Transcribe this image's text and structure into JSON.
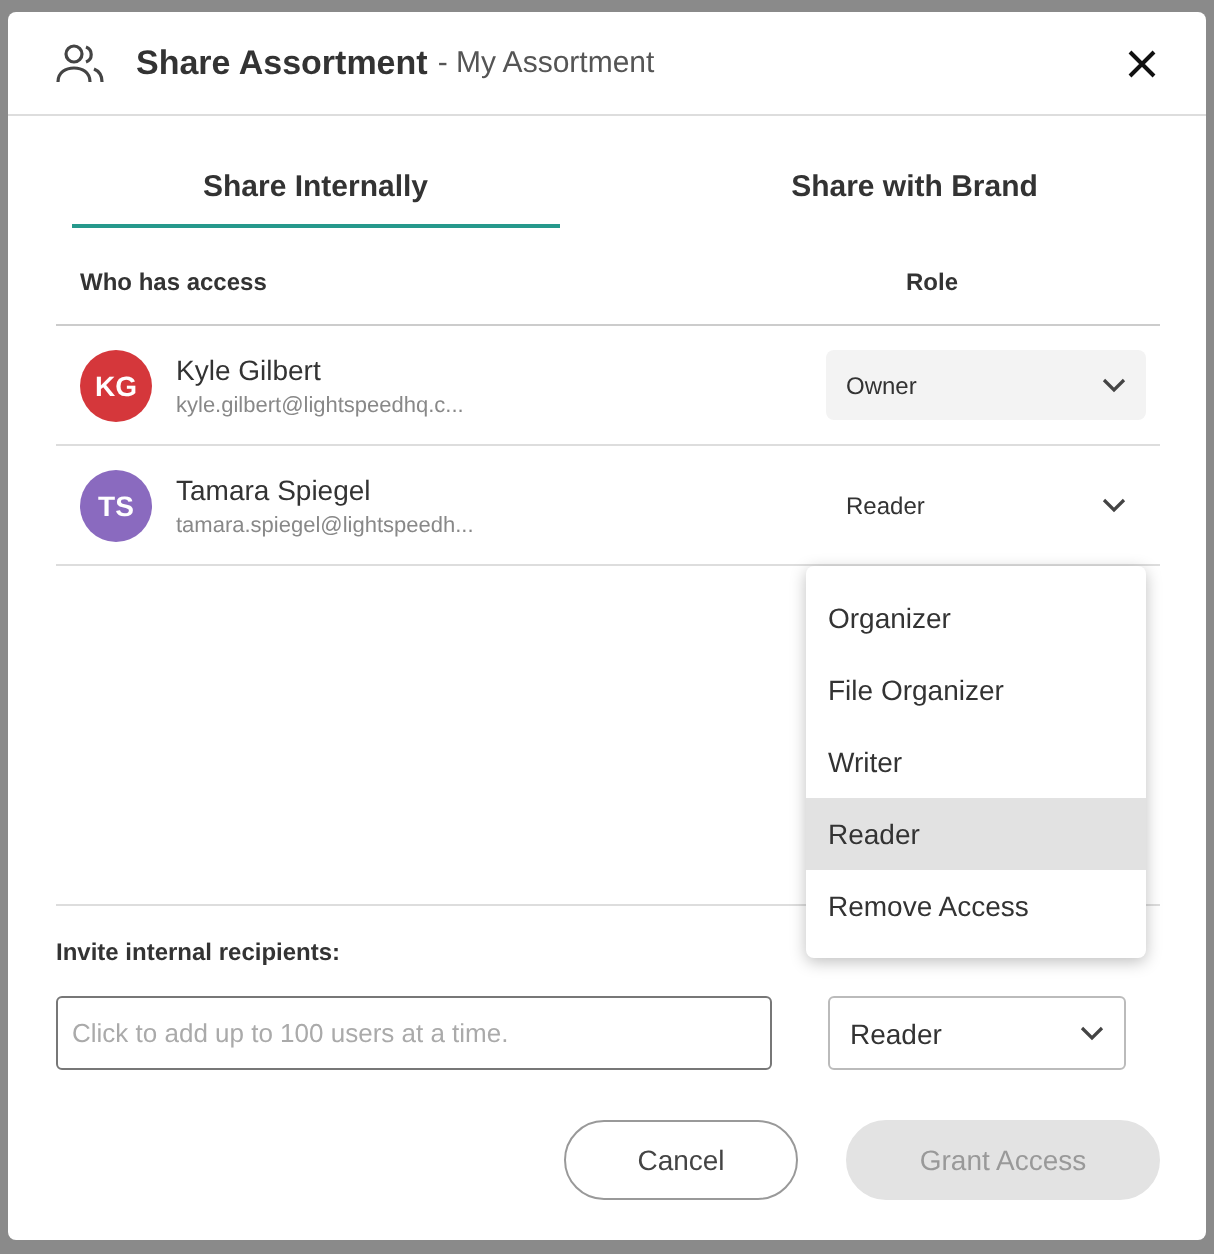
{
  "dialog": {
    "title": "Share Assortment",
    "subtitle": "- My Assortment"
  },
  "tabs": [
    {
      "label": "Share Internally",
      "selected": true
    },
    {
      "label": "Share with Brand",
      "selected": false
    }
  ],
  "access_table": {
    "columns": [
      "Who has access",
      "Role"
    ],
    "rows": [
      {
        "initials": "KG",
        "color": "#d5373b",
        "name": "Kyle Gilbert",
        "email": "kyle.gilbert@lightspeedhq.c...",
        "role": "Owner",
        "disabled": true
      },
      {
        "initials": "TS",
        "color": "#8a6abf",
        "name": "Tamara Spiegel",
        "email": "tamara.spiegel@lightspeedh...",
        "role": "Reader",
        "disabled": false
      }
    ]
  },
  "role_menu": {
    "items": [
      {
        "label": "Organizer",
        "selected": false
      },
      {
        "label": "File Organizer",
        "selected": false
      },
      {
        "label": "Writer",
        "selected": false
      },
      {
        "label": "Reader",
        "selected": true
      },
      {
        "label": "Remove Access",
        "selected": false
      }
    ]
  },
  "invite": {
    "label": "Invite internal recipients:",
    "placeholder": "Click to add up to 100 users at a time.",
    "permission": "Reader"
  },
  "buttons": [
    {
      "label": "Cancel",
      "disabled": false
    },
    {
      "label": "Grant Access",
      "disabled": true
    }
  ]
}
